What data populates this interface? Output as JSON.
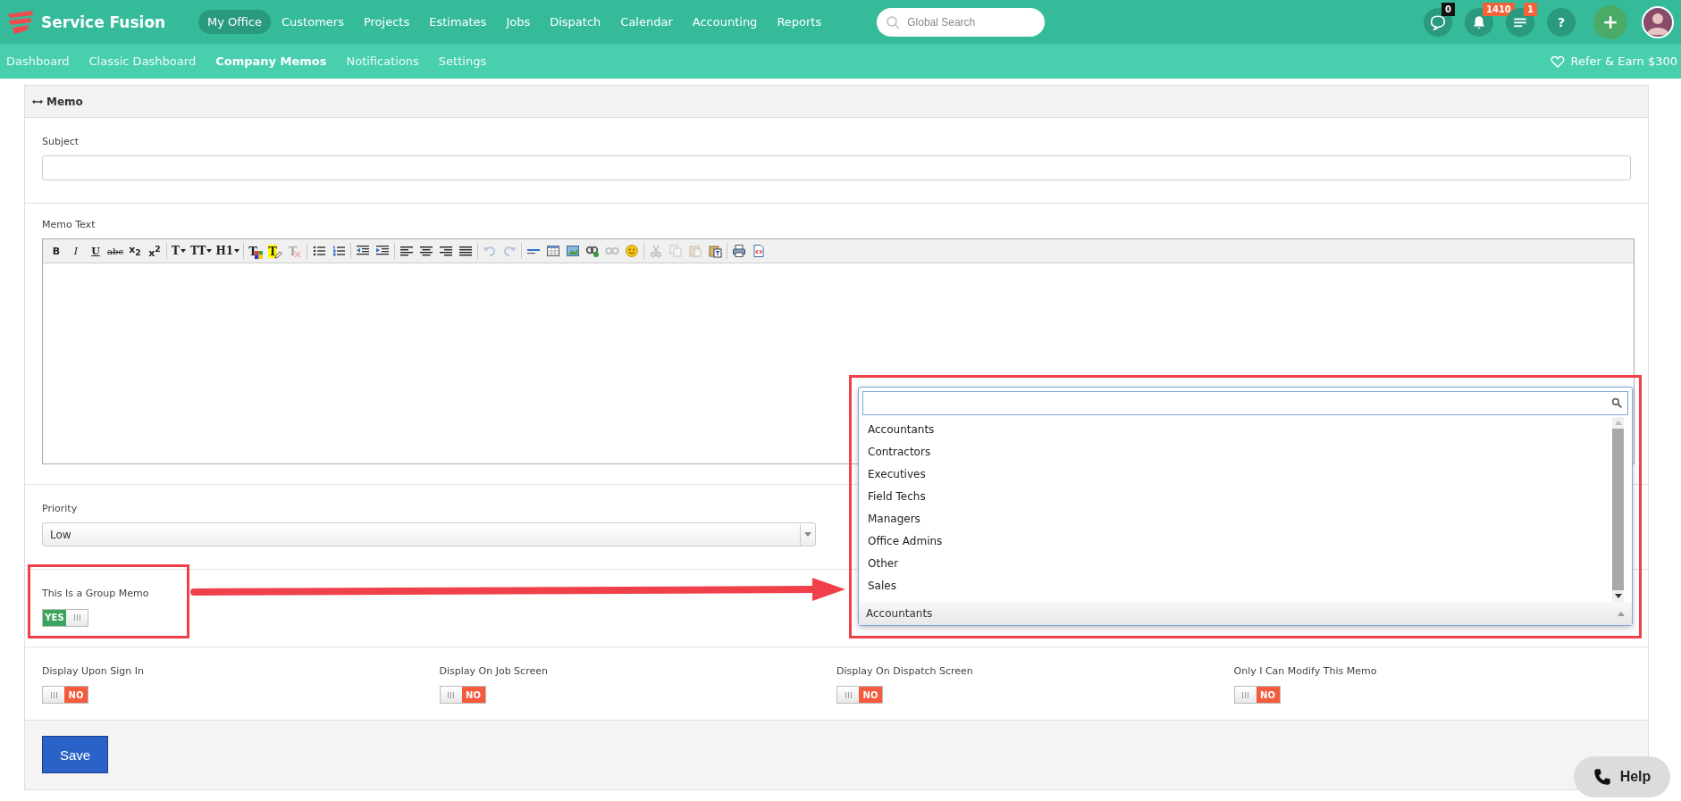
{
  "header": {
    "logo": "Service Fusion",
    "nav": [
      {
        "label": "My Office",
        "selected": true
      },
      {
        "label": "Customers",
        "selected": false
      },
      {
        "label": "Projects",
        "selected": false
      },
      {
        "label": "Estimates",
        "selected": false
      },
      {
        "label": "Jobs",
        "selected": false
      },
      {
        "label": "Dispatch",
        "selected": false
      },
      {
        "label": "Calendar",
        "selected": false
      },
      {
        "label": "Accounting",
        "selected": false
      },
      {
        "label": "Reports",
        "selected": false
      }
    ],
    "search": {
      "placeholder": "Global Search"
    },
    "actions": [
      {
        "kind": "chat",
        "badge": {
          "text": "0",
          "color": "#111111"
        }
      },
      {
        "kind": "bell",
        "badge": {
          "text": "1410",
          "color": "#f4623a"
        }
      },
      {
        "kind": "list",
        "badge": {
          "text": "1",
          "color": "#f4623a"
        }
      },
      {
        "kind": "help",
        "label": "?"
      },
      {
        "kind": "add"
      },
      {
        "kind": "avatar"
      }
    ]
  },
  "subnav": {
    "items": [
      {
        "label": "Dashboard",
        "selected": false
      },
      {
        "label": "Classic Dashboard",
        "selected": false
      },
      {
        "label": "Company Memos",
        "selected": true
      },
      {
        "label": "Notifications",
        "selected": false
      },
      {
        "label": "Settings",
        "selected": false
      }
    ],
    "refer": "Refer & Earn $300"
  },
  "panel": {
    "title": "Memo"
  },
  "subject": {
    "label": "Subject"
  },
  "memo_text": {
    "label": "Memo Text",
    "toolbar": [
      {
        "kind": "text",
        "label": "B",
        "disabled": false
      },
      {
        "kind": "text",
        "label": "I",
        "disabled": false
      },
      {
        "kind": "text",
        "label": "U",
        "disabled": false
      },
      {
        "kind": "text",
        "label": "abc",
        "disabled": false
      },
      {
        "kind": "text",
        "label": "x$_{2}$",
        "disabled": false
      },
      {
        "kind": "text",
        "label": "x$^{2}$",
        "disabled": false
      },
      {
        "kind": "sep"
      },
      {
        "kind": "text",
        "label": "T",
        "menu": true,
        "disabled": false
      },
      {
        "kind": "text",
        "label": "TT",
        "menu": true,
        "disabled": false
      },
      {
        "kind": "text",
        "label": "H1",
        "menu": true,
        "disabled": false
      },
      {
        "kind": "sep"
      },
      {
        "kind": "text",
        "label": "T",
        "disabled": false
      },
      {
        "kind": "text",
        "label": "T",
        "disabled": false
      },
      {
        "kind": "text",
        "label": "T",
        "disabled": true
      },
      {
        "kind": "sep"
      },
      {
        "kind": "icon",
        "disabled": false
      },
      {
        "kind": "icon",
        "disabled": false
      },
      {
        "kind": "sep"
      },
      {
        "kind": "icon",
        "disabled": false
      },
      {
        "kind": "icon",
        "disabled": false
      },
      {
        "kind": "sep"
      },
      {
        "kind": "icon",
        "disabled": false
      },
      {
        "kind": "icon",
        "disabled": false
      },
      {
        "kind": "icon",
        "disabled": false
      },
      {
        "kind": "icon",
        "disabled": false
      },
      {
        "kind": "sep"
      },
      {
        "kind": "icon",
        "disabled": true
      },
      {
        "kind": "icon",
        "disabled": true
      },
      {
        "kind": "sep"
      },
      {
        "kind": "icon",
        "disabled": false
      },
      {
        "kind": "icon",
        "disabled": false
      },
      {
        "kind": "icon",
        "disabled": false
      },
      {
        "kind": "icon",
        "disabled": false
      },
      {
        "kind": "icon",
        "disabled": true
      },
      {
        "kind": "icon",
        "disabled": false
      },
      {
        "kind": "sep"
      },
      {
        "kind": "icon",
        "disabled": true
      },
      {
        "kind": "icon",
        "disabled": true
      },
      {
        "kind": "icon",
        "disabled": true
      },
      {
        "kind": "icon",
        "disabled": false
      },
      {
        "kind": "sep"
      },
      {
        "kind": "icon",
        "disabled": false
      },
      {
        "kind": "icon",
        "disabled": false
      }
    ]
  },
  "priority": {
    "label": "Priority",
    "value": "Low"
  },
  "group_memo": {
    "label": "This Is a Group Memo",
    "on": true,
    "text": "YES",
    "annotated": true
  },
  "group_picker": {
    "options": [
      "Accountants",
      "Contractors",
      "Executives",
      "Field Techs",
      "Managers",
      "Office Admins",
      "Other",
      "Sales"
    ],
    "value": "Accountants",
    "annotated": true
  },
  "toggles": [
    {
      "label": "Display Upon Sign In",
      "on": false,
      "text": "NO"
    },
    {
      "label": "Display On Job Screen",
      "on": false,
      "text": "NO"
    },
    {
      "label": "Display On Dispatch Screen",
      "on": false,
      "text": "NO"
    },
    {
      "label": "Only I Can Modify This Memo",
      "on": false,
      "text": "NO"
    }
  ],
  "save": "Save",
  "help": "Help"
}
